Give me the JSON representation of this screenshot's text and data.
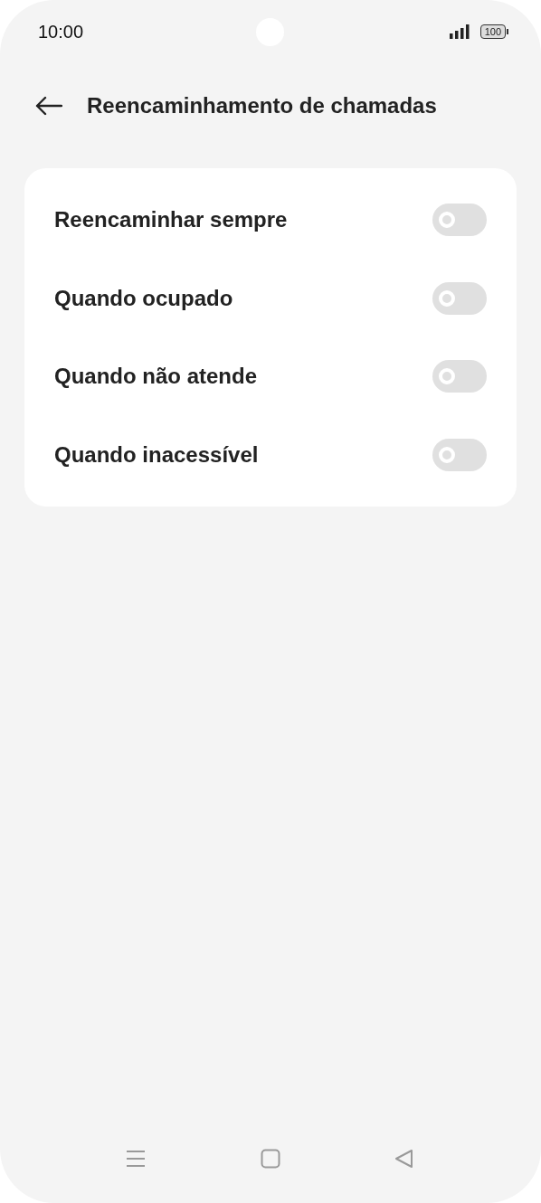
{
  "status_bar": {
    "time": "10:00",
    "battery": "100"
  },
  "header": {
    "title": "Reencaminhamento de chamadas"
  },
  "settings": [
    {
      "label": "Reencaminhar sempre",
      "on": false
    },
    {
      "label": "Quando ocupado",
      "on": false
    },
    {
      "label": "Quando não atende",
      "on": false
    },
    {
      "label": "Quando inacessível",
      "on": false
    }
  ]
}
